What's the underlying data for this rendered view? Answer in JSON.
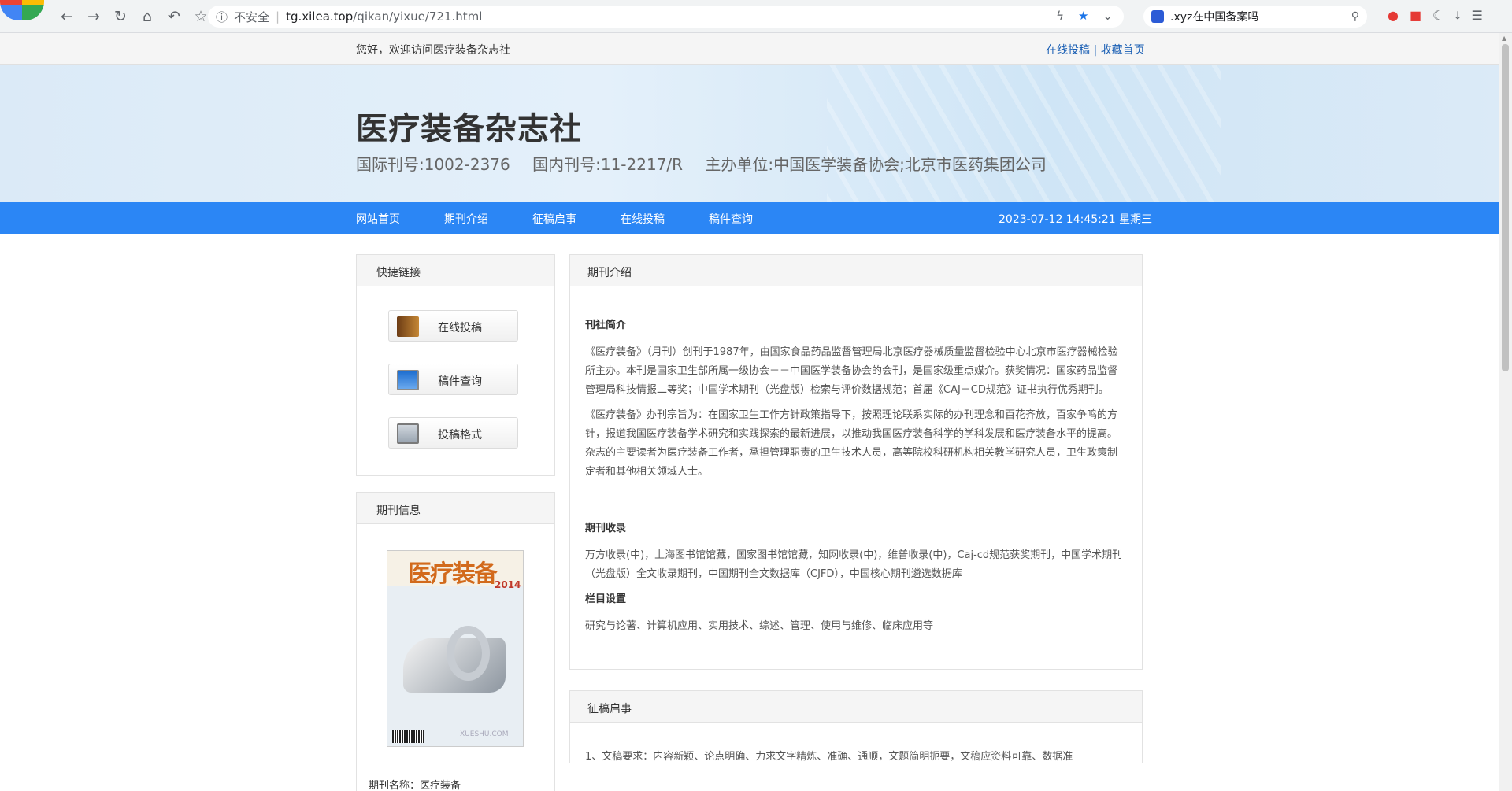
{
  "browser": {
    "security_label": "不安全",
    "url_host": "tg.xilea.top",
    "url_path": "/qikan/yixue/721.html",
    "search_text": ".xyz在中国备案吗"
  },
  "topbar": {
    "welcome": "您好，欢迎访问医疗装备杂志社",
    "link_submit": "在线投稿",
    "separator": "|",
    "link_bookmark": "收藏首页"
  },
  "header": {
    "title": "医疗装备杂志社",
    "issn": "国际刊号:1002-2376",
    "cn": "国内刊号:11-2217/R",
    "sponsor": "主办单位:中国医学装备协会;北京市医药集团公司"
  },
  "nav": {
    "items": [
      "网站首页",
      "期刊介绍",
      "征稿启事",
      "在线投稿",
      "稿件查询"
    ],
    "datetime": "2023-07-12 14:45:21 星期三"
  },
  "sidebar": {
    "quick_title": "快捷链接",
    "quick_links": [
      "在线投稿",
      "稿件查询",
      "投稿格式"
    ],
    "info_title": "期刊信息",
    "cover_title": "医疗装备",
    "cover_year": "2014",
    "cover_watermark": "XUESHU.COM",
    "journal_name": "期刊名称：医疗装备"
  },
  "content": {
    "panel_title": "期刊介绍",
    "intro_title": "刊社简介",
    "intro_p1": "《医疗装备》（月刊）创刊于1987年，由国家食品药品监督管理局北京医疗器械质量监督检验中心北京市医疗器械检验所主办。本刊是国家卫生部所属一级协会－－中国医学装备协会的会刊，是国家级重点媒介。获奖情况：国家药品监督管理局科技情报二等奖；中国学术期刊（光盘版）检索与评价数据规范；首届《CAJ－CD规范》证书执行优秀期刊。",
    "intro_p2": "《医疗装备》办刊宗旨为：在国家卫生工作方针政策指导下，按照理论联系实际的办刊理念和百花齐放，百家争鸣的方针，报道我国医疗装备学术研究和实践探索的最新进展，以推动我国医疗装备科学的学科发展和医疗装备水平的提高。杂志的主要读者为医疗装备工作者，承担管理职责的卫生技术人员，高等院校科研机构相关教学研究人员，卫生政策制定者和其他相关领域人士。",
    "index_title": "期刊收录",
    "index_text": "万方收录(中)，上海图书馆馆藏，国家图书馆馆藏，知网收录(中)，维普收录(中)，Caj-cd规范获奖期刊，中国学术期刊（光盘版）全文收录期刊，中国期刊全文数据库（CJFD），中国核心期刊遴选数据库",
    "columns_title": "栏目设置",
    "columns_text": "研究与论著、计算机应用、实用技术、综述、管理、使用与维修、临床应用等",
    "panel2_title": "征稿启事",
    "panel2_text": "1、文稿要求：内容新颖、论点明确、力求文字精炼、准确、通顺，文题简明扼要，文稿应资料可靠、数据准"
  }
}
